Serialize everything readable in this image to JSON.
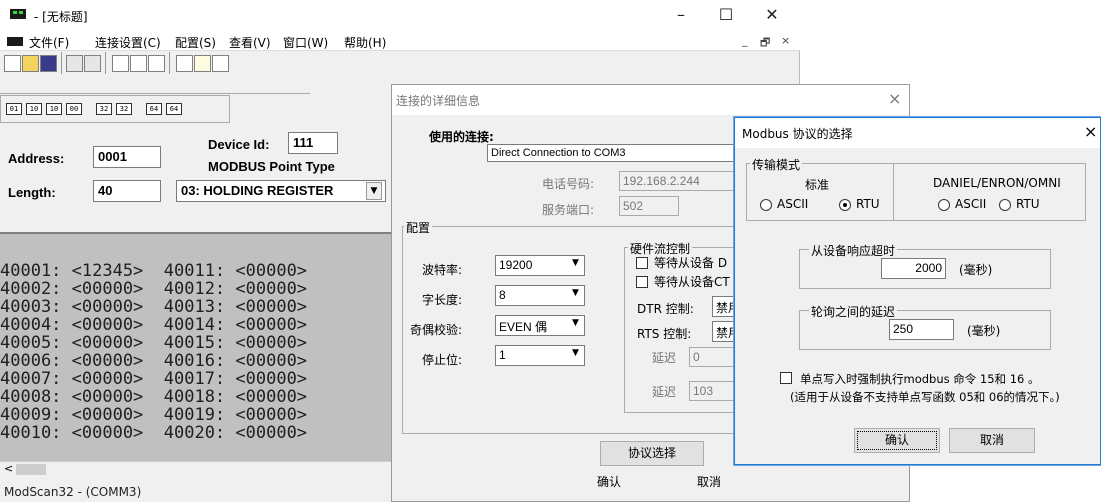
{
  "app": {
    "title": " - [无标题]",
    "menu": [
      "文件(F)",
      "连接设置(C)",
      "配置(S)",
      "查看(V)",
      "窗口(W)",
      "帮助(H)"
    ],
    "window_controls": [
      "–",
      "☐",
      "✕"
    ],
    "mdi_controls": [
      "_",
      "🗗",
      "×"
    ]
  },
  "toolbar": {
    "mode_buttons": [
      "01",
      "10",
      "10",
      "00",
      "32",
      "32",
      "64",
      "64"
    ]
  },
  "panel": {
    "address_label": "Address:",
    "address_value": "0001",
    "length_label": "Length:",
    "length_value": "40",
    "device_id_label": "Device Id:",
    "device_id_value": "111",
    "point_type_label": "MODBUS Point Type",
    "point_type_value": "03: HOLDING REGISTER"
  },
  "data_lines": [
    "40001: <12345>  40011: <00000>",
    "40002: <00000>  40012: <00000>",
    "40003: <00000>  40013: <00000>",
    "40004: <00000>  40014: <00000>",
    "40005: <00000>  40015: <00000>",
    "40006: <00000>  40016: <00000>",
    "40007: <00000>  40017: <00000>",
    "40008: <00000>  40018: <00000>",
    "40009: <00000>  40019: <00000>",
    "40010: <00000>  40020: <00000>"
  ],
  "statusbar": "ModScan32 - (COMM3)",
  "conn_dialog": {
    "title": "连接的详细信息",
    "close": "×",
    "use_conn_label": "使用的连接:",
    "use_conn_value": "Direct Connection to COM3",
    "phone_label": "电话号码:",
    "phone_value": "192.168.2.244",
    "port_label": "服务端口:",
    "port_value": "502",
    "config_group": "配置",
    "baud_label": "波特率:",
    "baud_value": "19200",
    "wordlen_label": "字长度:",
    "wordlen_value": "8",
    "parity_label": "奇偶校验:",
    "parity_value": "EVEN 偶",
    "stop_label": "停止位:",
    "stop_value": "1",
    "hw_group": "硬件流控制",
    "wait_dsr": "等待从设备 D",
    "wait_cts": "等待从设备CT",
    "dtr_label": "DTR 控制:",
    "dtr_value": "禁用",
    "rts_label": "RTS 控制:",
    "rts_value": "禁用",
    "delay1_label": "延迟",
    "delay1_value": "0",
    "delay2_label": "延迟",
    "delay2_value": "103",
    "protocol_btn": "协议选择",
    "ok_btn": "确认",
    "cancel_btn": "取消"
  },
  "modbus_dialog": {
    "title": "Modbus 协议的选择",
    "close": "×",
    "transfer_group": "传输模式",
    "standard_label": "标准",
    "daniel_label": "DANIEL/ENRON/OMNI",
    "ascii": "ASCII",
    "rtu": "RTU",
    "std_selected": "RTU",
    "timeout_group": "从设备响应超时",
    "timeout_value": "2000",
    "timeout_unit": "(毫秒)",
    "delay_group": "轮询之间的延迟",
    "delay_value": "250",
    "delay_unit": "(毫秒)",
    "force_label": "单点写入时强制执行modbus 命令 15和 16 。",
    "force_note": "(适用于从设备不支持单点写函数 05和 06的情况下。)",
    "ok_btn": "确认",
    "cancel_btn": "取消"
  }
}
